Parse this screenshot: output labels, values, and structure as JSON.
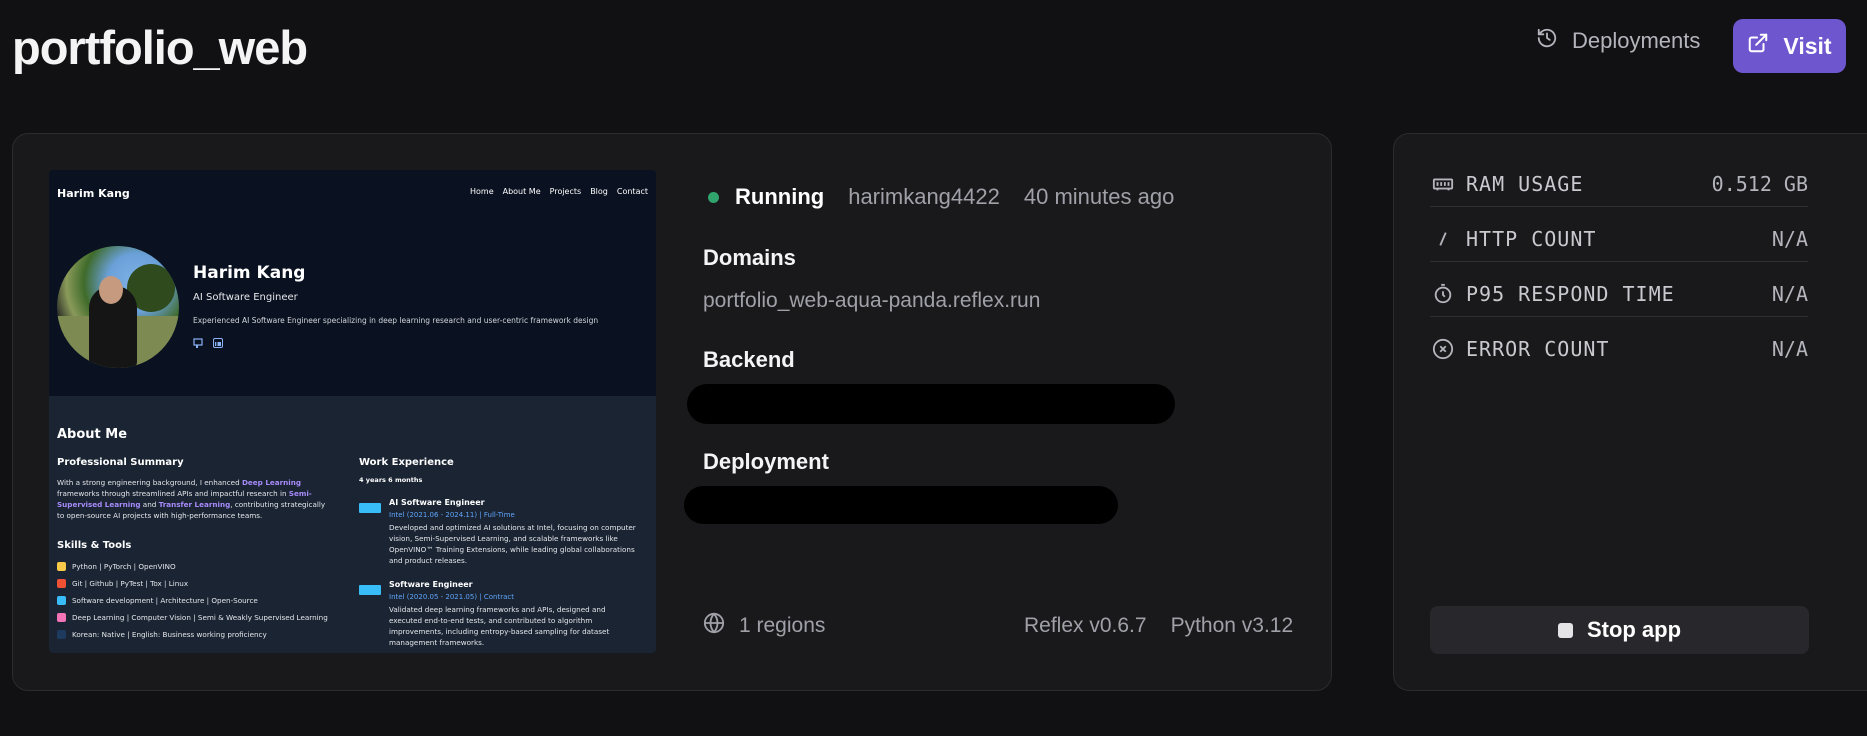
{
  "header": {
    "title": "portfolio_web",
    "deployments_label": "Deployments",
    "visit_label": "Visit"
  },
  "preview": {
    "site_name": "Harim Kang",
    "nav": [
      "Home",
      "About Me",
      "Projects",
      "Blog",
      "Contact"
    ],
    "hero_name": "Harim Kang",
    "hero_role": "AI Software Engineer",
    "hero_desc": "Experienced AI Software Engineer specializing in deep learning research and user-centric framework design",
    "about_title": "About Me",
    "summary_title": "Professional Summary",
    "summary_pre": "With a strong engineering background, I enhanced ",
    "summary_hl1": "Deep Learning",
    "summary_mid1": " frameworks through streamlined APIs and impactful research in ",
    "summary_hl2": "Semi-Supervised Learning",
    "summary_mid2": " and ",
    "summary_hl3": "Transfer Learning",
    "summary_post": ", contributing strategically to open-source AI projects with high-performance teams.",
    "skills_title": "Skills & Tools",
    "skills": [
      "Python | PyTorch | OpenVINO",
      "Git | Github | PyTest | Tox | Linux",
      "Software development | Architecture | Open-Source",
      "Deep Learning | Computer Vision | Semi & Weakly Supervised Learning",
      "Korean: Native | English: Business working proficiency"
    ],
    "work_title": "Work Experience",
    "work_duration": "4 years 6 months",
    "jobs": [
      {
        "title": "AI Software Engineer",
        "meta": "Intel (2021.06 - 2024.11) | Full-Time",
        "desc": "Developed and optimized AI solutions at Intel, focusing on computer vision, Semi-Supervised Learning, and scalable frameworks like OpenVINO™ Training Extensions, while leading global collaborations and product releases."
      },
      {
        "title": "Software Engineer",
        "meta": "Intel (2020.05 - 2021.05) | Contract",
        "desc": "Validated deep learning frameworks and APIs, designed and executed end-to-end tests, and contributed to algorithm improvements, including entropy-based sampling for dataset management frameworks."
      }
    ]
  },
  "status": {
    "state": "Running",
    "user": "harimkang4422",
    "time": "40 minutes ago"
  },
  "domains": {
    "label": "Domains",
    "url": "portfolio_web-aqua-panda.reflex.run"
  },
  "backend": {
    "label": "Backend"
  },
  "deployment": {
    "label": "Deployment"
  },
  "footer": {
    "regions": "1 regions",
    "reflex_version": "Reflex v0.6.7",
    "python_version": "Python v3.12"
  },
  "metrics": [
    {
      "icon": "memory-icon",
      "label": "RAM USAGE",
      "value": "0.512 GB"
    },
    {
      "icon": "slash-icon",
      "label": "HTTP COUNT",
      "value": "N/A"
    },
    {
      "icon": "timer-icon",
      "label": "P95 RESPOND TIME",
      "value": "N/A"
    },
    {
      "icon": "cross-circle-icon",
      "label": "ERROR COUNT",
      "value": "N/A"
    }
  ],
  "stop_button": {
    "label": "Stop app"
  },
  "colors": {
    "accent": "#6e56cf",
    "running": "#30a46c",
    "background": "#111113",
    "card": "#19191b"
  }
}
